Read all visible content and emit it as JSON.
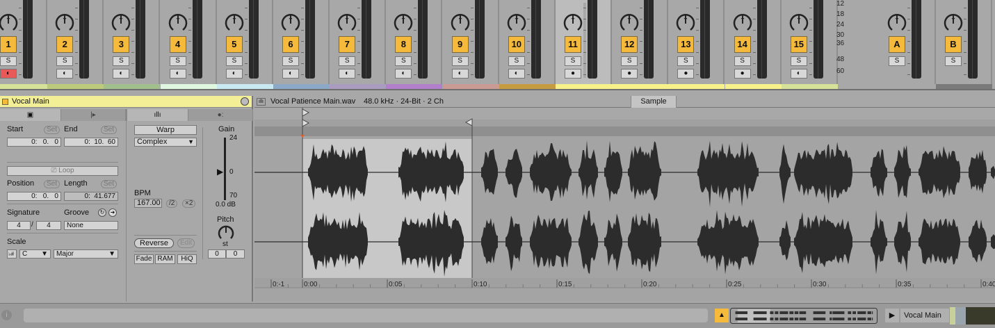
{
  "mixer": {
    "tracks": [
      {
        "label": "1",
        "color": "#d6e29a",
        "arm": "red"
      },
      {
        "label": "2",
        "color": "#bccb7b",
        "arm": "icon"
      },
      {
        "label": "3",
        "color": "#a2c08d",
        "arm": "icon"
      },
      {
        "label": "4",
        "color": "#e0f7df",
        "arm": "icon"
      },
      {
        "label": "5",
        "color": "#c8e9f1",
        "arm": "icon"
      },
      {
        "label": "6",
        "color": "#8ba8c6",
        "arm": "icon"
      },
      {
        "label": "7",
        "color": "#a99cbe",
        "arm": "icon"
      },
      {
        "label": "8",
        "color": "#b280ca",
        "arm": "icon"
      },
      {
        "label": "9",
        "color": "#ca9b94",
        "arm": "icon"
      },
      {
        "label": "10",
        "color": "#c59b41",
        "arm": "icon"
      },
      {
        "label": "11",
        "color": "#f7f18b",
        "arm": "dot"
      },
      {
        "label": "12",
        "color": "#f7f18b",
        "arm": "dot"
      },
      {
        "label": "13",
        "color": "#f7f18b",
        "arm": "dot"
      },
      {
        "label": "14",
        "color": "#f7f18b",
        "arm": "dot"
      },
      {
        "label": "15",
        "color": "#d6e29a",
        "arm": "icon"
      }
    ],
    "returns": [
      {
        "label": "A",
        "color": "#a8a8a8"
      },
      {
        "label": "B",
        "color": "#7a7a7a"
      }
    ],
    "solo_label": "S",
    "db_scale": [
      "12",
      "18",
      "24",
      "30",
      "36",
      "48",
      "60"
    ]
  },
  "clip": {
    "name": "Vocal Main",
    "start_label": "Start",
    "end_label": "End",
    "set_label": "Set",
    "start": "0:   0.   0",
    "end": "0:  10.  60",
    "loop_label": "Loop",
    "position_label": "Position",
    "length_label": "Length",
    "position": "0:   0.   0",
    "length": "0:  41.677",
    "signature_label": "Signature",
    "groove_label": "Groove",
    "sig_num": "4",
    "sig_den": "4",
    "groove": "None",
    "scale_label": "Scale",
    "scale_root": "C",
    "scale_mode": "Major",
    "warp_label": "Warp",
    "warp_mode": "Complex",
    "bpm_label": "BPM",
    "bpm": "167.00",
    "half": "/2",
    "double": "×2",
    "reverse": "Reverse",
    "edit": "Edit",
    "fade": "Fade",
    "ram": "RAM",
    "hiq": "HiQ",
    "gain_label": "Gain",
    "gain_max": "24",
    "gain_zero": "0",
    "gain_min": "70",
    "gain_value": "0.0 dB",
    "pitch_label": "Pitch",
    "pitch_unit": "st",
    "pitch_semi": "0",
    "pitch_cents": "0"
  },
  "sample": {
    "file": "Vocal Patience Main.wav",
    "info": "48.0 kHz · 24-Bit · 2 Ch",
    "tab": "Sample",
    "timeline": [
      "0:-1",
      "0:00",
      "0:05",
      "0:10",
      "0:15",
      "0:20",
      "0:25",
      "0:30",
      "0:35",
      "0:40"
    ]
  },
  "bottom": {
    "clip_name": "Vocal Main"
  }
}
